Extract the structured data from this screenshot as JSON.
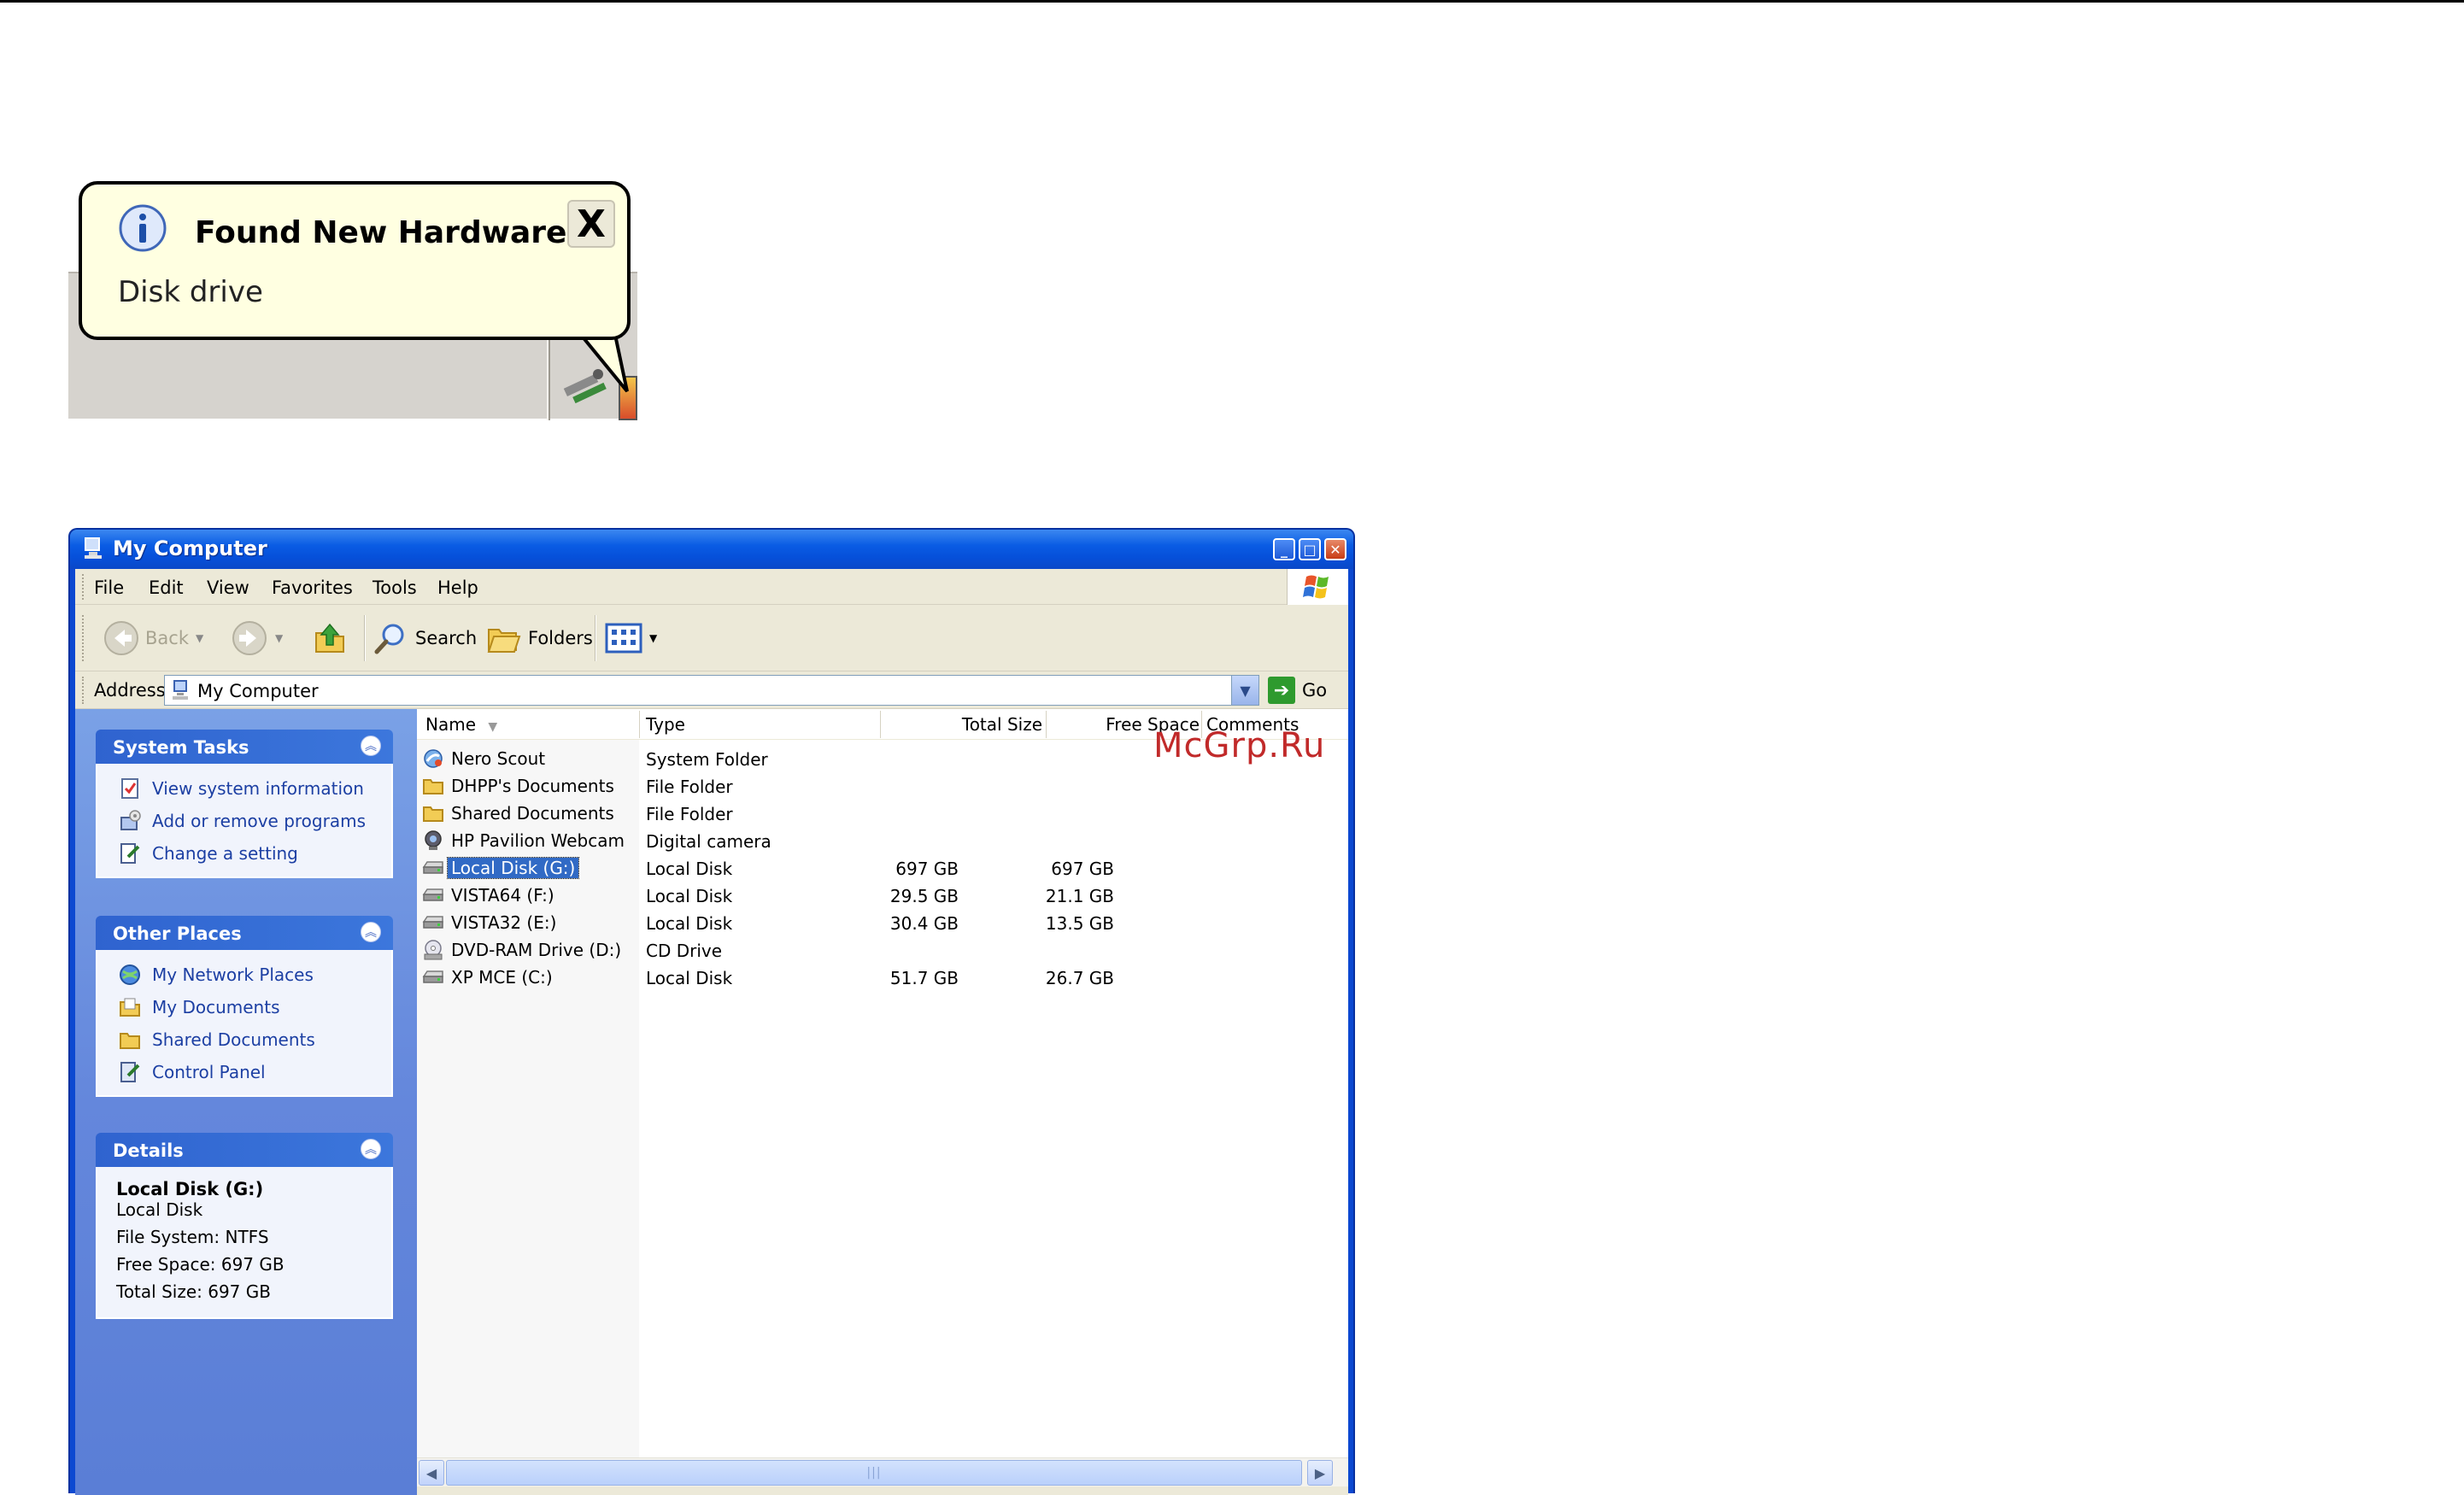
{
  "balloon": {
    "title": "Found New Hardware",
    "message": "Disk drive",
    "close_glyph": "X",
    "icon": "info-icon"
  },
  "window": {
    "title": "My Computer",
    "menu": [
      "File",
      "Edit",
      "View",
      "Favorites",
      "Tools",
      "Help"
    ],
    "toolbar": {
      "back_label": "Back",
      "search_label": "Search",
      "folders_label": "Folders"
    },
    "address": {
      "label": "Address",
      "value": "My Computer",
      "go_label": "Go"
    },
    "taskpane": {
      "system_tasks": {
        "title": "System Tasks",
        "items": [
          "View system information",
          "Add or remove programs",
          "Change a setting"
        ]
      },
      "other_places": {
        "title": "Other Places",
        "items": [
          "My Network Places",
          "My Documents",
          "Shared Documents",
          "Control Panel"
        ]
      },
      "details": {
        "title": "Details",
        "name": "Local Disk (G:)",
        "type": "Local Disk",
        "file_system": "File System: NTFS",
        "free_space": "Free Space: 697 GB",
        "total_size": "Total Size: 697 GB"
      }
    },
    "columns": {
      "name": "Name",
      "type": "Type",
      "total_size": "Total Size",
      "free_space": "Free Space",
      "comments": "Comments"
    },
    "rows": [
      {
        "name": "Nero Scout",
        "type": "System Folder",
        "total": "",
        "free": "",
        "icon": "nero-scout-icon"
      },
      {
        "name": "DHPP's Documents",
        "type": "File Folder",
        "total": "",
        "free": "",
        "icon": "folder-icon"
      },
      {
        "name": "Shared Documents",
        "type": "File Folder",
        "total": "",
        "free": "",
        "icon": "folder-icon"
      },
      {
        "name": "HP Pavilion Webcam",
        "type": "Digital camera",
        "total": "",
        "free": "",
        "icon": "webcam-icon"
      },
      {
        "name": "Local Disk (G:)",
        "type": "Local Disk",
        "total": "697 GB",
        "free": "697 GB",
        "icon": "hard-drive-icon"
      },
      {
        "name": "VISTA64 (F:)",
        "type": "Local Disk",
        "total": "29.5 GB",
        "free": "21.1 GB",
        "icon": "hard-drive-icon"
      },
      {
        "name": "VISTA32 (E:)",
        "type": "Local Disk",
        "total": "30.4 GB",
        "free": "13.5 GB",
        "icon": "hard-drive-icon"
      },
      {
        "name": "DVD-RAM Drive (D:)",
        "type": "CD Drive",
        "total": "",
        "free": "",
        "icon": "cd-drive-icon"
      },
      {
        "name": "XP MCE (C:)",
        "type": "Local Disk",
        "total": "51.7 GB",
        "free": "26.7 GB",
        "icon": "hard-drive-icon"
      }
    ],
    "selected_row": 4
  },
  "watermark": "McGrp.Ru",
  "colors": {
    "title_blue": "#0a5ce4",
    "selection": "#316ac5",
    "task_link": "#1c3fa3",
    "balloon_fill": "#ffffe1",
    "watermark_red": "#c12a2a"
  }
}
